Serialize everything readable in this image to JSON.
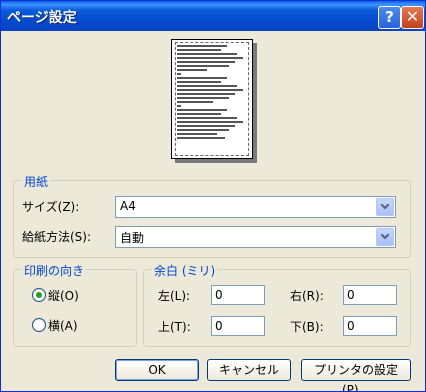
{
  "window": {
    "title": "ページ設定",
    "help_glyph": "?",
    "close_glyph": "✕"
  },
  "paper_group": {
    "legend": "用紙",
    "size_label": "サイズ(Z):",
    "size_value": "A4",
    "source_label": "給紙方法(S):",
    "source_value": "自動"
  },
  "orientation_group": {
    "legend": "印刷の向き",
    "portrait_label": "縦(O)",
    "landscape_label": "横(A)",
    "selected": "portrait"
  },
  "margin_group": {
    "legend": "余白 (ミリ)",
    "left_label": "左(L):",
    "left_value": "0",
    "right_label": "右(R):",
    "right_value": "0",
    "top_label": "上(T):",
    "top_value": "0",
    "bottom_label": "下(B):",
    "bottom_value": "0"
  },
  "buttons": {
    "ok": "OK",
    "cancel": "キャンセル",
    "printer": "プリンタの設定(P)..."
  }
}
